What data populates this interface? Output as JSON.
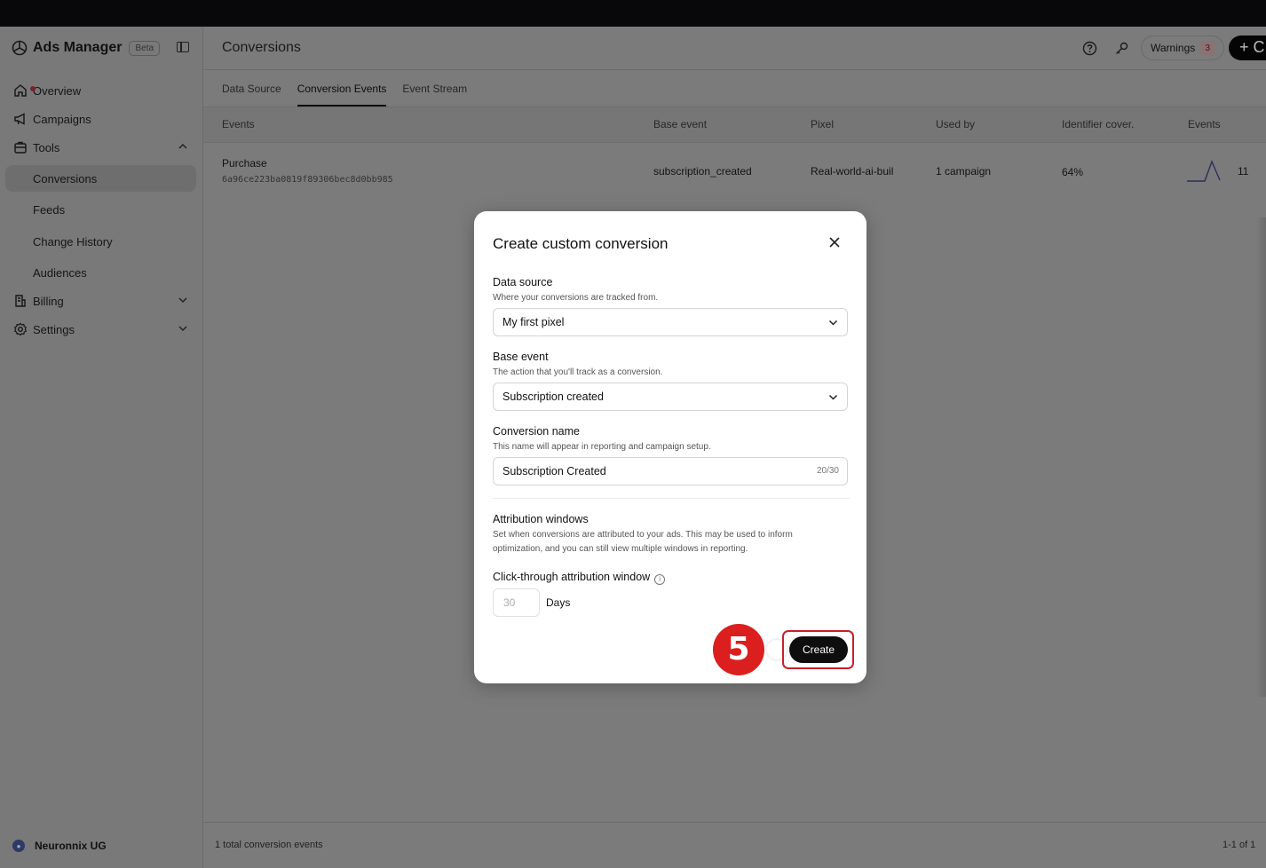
{
  "app": {
    "title": "Ads Manager",
    "badge": "Beta",
    "organization": "Neuronnix UG"
  },
  "sidebar": {
    "items": [
      {
        "label": "Overview",
        "icon": "home-icon"
      },
      {
        "label": "Campaigns",
        "icon": "megaphone-icon"
      },
      {
        "label": "Tools",
        "icon": "toolbox-icon",
        "expanded": true
      },
      {
        "label": "Conversions",
        "active": true
      },
      {
        "label": "Feeds"
      },
      {
        "label": "Change History"
      },
      {
        "label": "Audiences"
      },
      {
        "label": "Billing",
        "icon": "receipt-icon",
        "expanded": false
      },
      {
        "label": "Settings",
        "icon": "gear-icon",
        "expanded": false
      }
    ]
  },
  "header": {
    "title": "Conversions",
    "warnings_label": "Warnings",
    "warnings_count": "3",
    "new_button": "+ C"
  },
  "tabs": [
    {
      "label": "Data Source"
    },
    {
      "label": "Conversion Events",
      "active": true
    },
    {
      "label": "Event Stream"
    }
  ],
  "table": {
    "columns": [
      "Events",
      "Base event",
      "Pixel",
      "Used by",
      "Identifier cover.",
      "Events"
    ],
    "rows": [
      {
        "name": "Purchase",
        "id": "6a96ce223ba0819f89306bec8d0bb985",
        "base_event": "subscription_created",
        "pixel": "Real-world-ai-buil",
        "used_by": "1 campaign",
        "identifier_coverage": "64%",
        "events_count": "11"
      }
    ]
  },
  "footer": {
    "total": "1 total conversion events",
    "pagination": "1-1 of 1"
  },
  "modal": {
    "title": "Create custom conversion",
    "data_source": {
      "label": "Data source",
      "help": "Where your conversions are tracked from.",
      "value": "My first pixel"
    },
    "base_event": {
      "label": "Base event",
      "help": "The action that you'll track as a conversion.",
      "value": "Subscription created"
    },
    "conversion_name": {
      "label": "Conversion name",
      "help": "This name will appear in reporting and campaign setup.",
      "value": "Subscription Created",
      "counter": "20/30"
    },
    "attribution": {
      "label": "Attribution windows",
      "help": "Set when conversions are attributed to your ads. This may be used to inform optimization, and you can still view multiple windows in reporting."
    },
    "click_through": {
      "label": "Click-through attribution window",
      "placeholder": "30",
      "unit": "Days"
    },
    "create_button": "Create"
  },
  "annotation": {
    "step": "5",
    "color": "#db1f1f"
  }
}
